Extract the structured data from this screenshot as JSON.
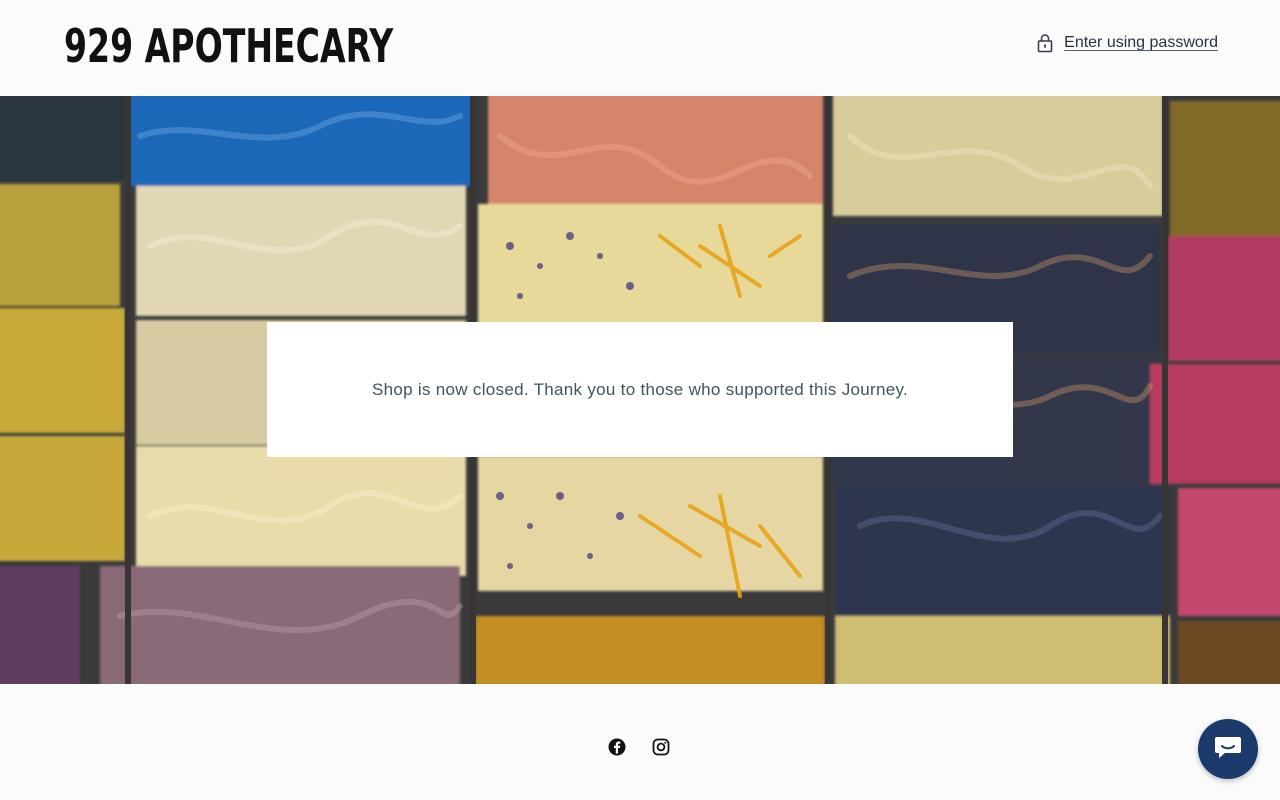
{
  "header": {
    "brand": "929 APOTHECARY",
    "password_link": "Enter using password"
  },
  "hero": {
    "message": "Shop is now closed. Thank you to those who supported this Journey."
  },
  "footer": {
    "social": [
      "facebook-icon",
      "instagram-icon"
    ]
  },
  "chat": {
    "icon": "chat-icon",
    "color": "#1b3a6b"
  },
  "colors": {
    "text": "#3c5661",
    "brand": "#111111"
  }
}
